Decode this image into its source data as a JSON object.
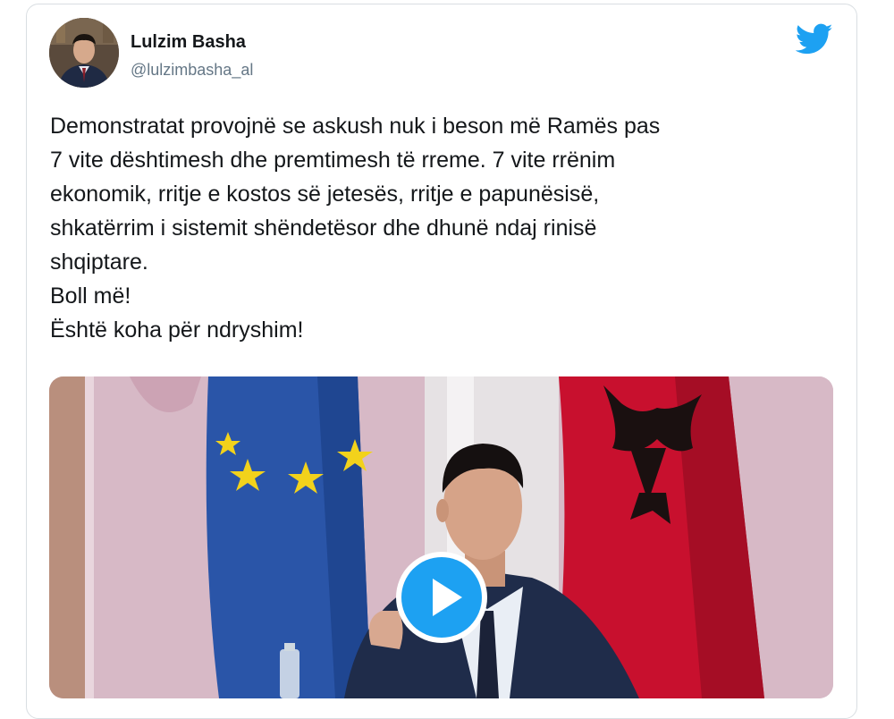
{
  "author": {
    "name": "Lulzim Basha",
    "handle": "@lulzimbasha_al"
  },
  "icons": {
    "brand": "twitter-bird-icon",
    "play": "play-icon"
  },
  "colors": {
    "twitter_blue": "#1da1f2",
    "text": "#14171a",
    "secondary": "#657786",
    "eu_blue": "#2a55a8",
    "eu_star": "#f2d21b",
    "albania_red": "#c8102e"
  },
  "tweet": {
    "lines": [
      "Demonstratat provojnë se askush nuk i beson më Ramës pas",
      "7 vite dështimesh dhe premtimesh të rreme. 7 vite rrënim",
      "ekonomik, rritje e kostos së jetesës, rritje e papunësisë,",
      "shkatërrim i sistemit shëndetësor dhe dhunë ndaj rinisë",
      "shqiptare.",
      "Boll më!",
      "Është koha për ndryshim!"
    ]
  }
}
